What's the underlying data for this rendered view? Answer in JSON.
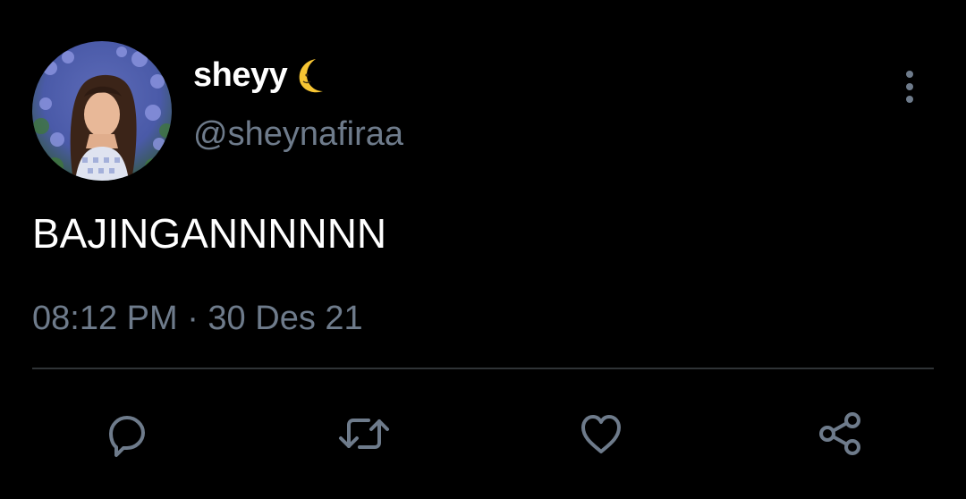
{
  "tweet": {
    "display_name": "sheyy",
    "display_name_emoji": "crescent-moon-emoji",
    "handle": "@sheynafiraa",
    "text": "BAJINGANNNNNN",
    "timestamp": "08:12 PM · 30 Des 21"
  },
  "actions": {
    "icons": [
      "reply-icon",
      "retweet-icon",
      "like-icon",
      "share-icon"
    ]
  },
  "colors": {
    "background": "#000000",
    "primary_text": "#ffffff",
    "secondary_text": "#6e7b8b",
    "divider": "#2f3336"
  }
}
